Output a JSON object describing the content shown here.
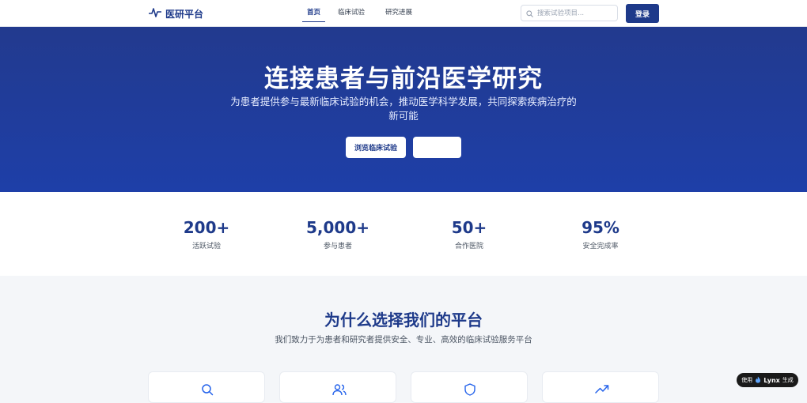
{
  "header": {
    "logo_text": "医研平台",
    "nav": [
      "首页",
      "临床试验",
      "研究进展"
    ],
    "search_placeholder": "搜索试验项目...",
    "login_label": "登录"
  },
  "hero": {
    "title": "连接患者与前沿医学研究",
    "subtitle": "为患者提供参与最新临床试验的机会，推动医学科学发展，共同探索疾病治疗的新可能",
    "primary_button": "浏览临床试验",
    "secondary_button": ""
  },
  "stats": [
    {
      "value": "200+",
      "label": "活跃试验"
    },
    {
      "value": "5,000+",
      "label": "参与患者"
    },
    {
      "value": "50+",
      "label": "合作医院"
    },
    {
      "value": "95%",
      "label": "安全完成率"
    }
  ],
  "why": {
    "title": "为什么选择我们的平台",
    "subtitle": "我们致力于为患者和研究者提供安全、专业、高效的临床试验服务平台",
    "cards": [
      {
        "icon": "search-icon"
      },
      {
        "icon": "users-icon"
      },
      {
        "icon": "shield-icon"
      },
      {
        "icon": "trending-up-icon"
      }
    ]
  },
  "badge": {
    "prefix": "使用",
    "brand": "Lynx",
    "suffix": "生成"
  },
  "colors": {
    "primary": "#1e3a8a",
    "hero_start": "#223a8e",
    "hero_end": "#1e3fa8",
    "accent_icon": "#2563eb"
  }
}
